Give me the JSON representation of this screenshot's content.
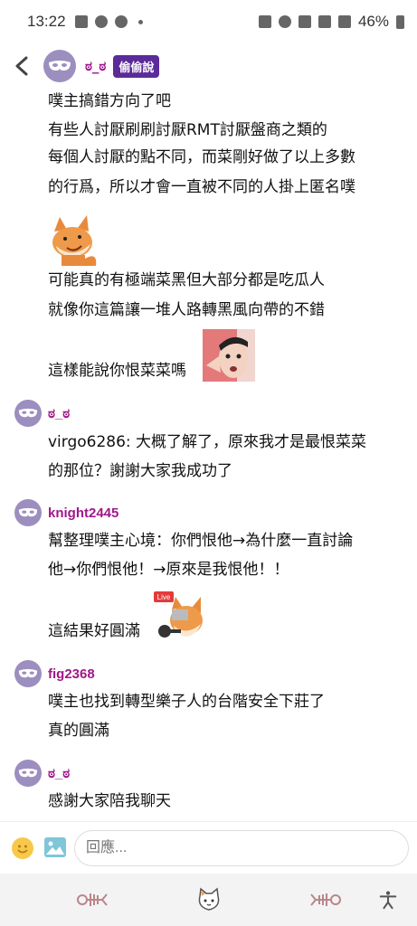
{
  "status": {
    "time": "13:22",
    "battery": "46%"
  },
  "header": {
    "name": "ಠ_ಠ",
    "badge": "偷偷說"
  },
  "lines": [
    "噗主搞錯方向了吧",
    "有些人討厭刷刷討厭RMT討厭盤商之類的",
    "每個人討厭的點不同，而菜剛好做了以上多數",
    "的行爲，所以才會一直被不同的人掛上匿名噗",
    "可能真的有極端菜黑但大部分都是吃瓜人",
    "就像你這篇讓一堆人路轉黑風向帶的不錯",
    "這樣能說你恨菜菜嗎"
  ],
  "replies": [
    {
      "name": "ಠ_ಠ",
      "lines": [
        "virgo6286: 大概了解了，原來我才是最恨菜菜",
        "的那位？謝謝大家我成功了"
      ]
    },
    {
      "name": "knight2445",
      "lines": [
        "幫整理噗主心境：你們恨他→為什麼一直討論",
        "他→你們恨他！→原來是我恨他！！",
        "這結果好圓滿"
      ]
    },
    {
      "name": "fig2368",
      "lines": [
        "噗主也找到轉型樂子人的台階安全下莊了",
        "真的圓滿"
      ]
    },
    {
      "name": "ಠ_ಠ",
      "lines": [
        "感謝大家陪我聊天"
      ]
    }
  ],
  "stickers": {
    "live_label": "Live"
  },
  "input": {
    "placeholder": "回應..."
  },
  "icons": {
    "back": "chevron-left-icon",
    "mask": "mask-icon",
    "emoji": "emoji-icon",
    "image": "image-icon",
    "nav": [
      "fishbone-icon",
      "cat-icon",
      "fishbone-icon",
      "accessibility-icon"
    ]
  },
  "colors": {
    "accent": "#a0178a",
    "badge": "#5b2b9a",
    "avatar": "#9c8ebf"
  }
}
